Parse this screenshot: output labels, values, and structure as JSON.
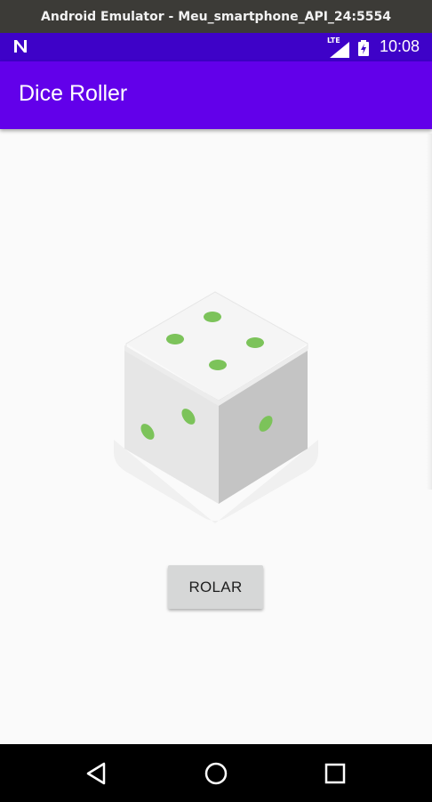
{
  "window": {
    "title": "Android Emulator - Meu_smartphone_API_24:5554"
  },
  "status_bar": {
    "network_label": "LTE",
    "time": "10:08"
  },
  "app_bar": {
    "title": "Dice Roller"
  },
  "dice": {
    "face_value_shown": 4,
    "pip_color": "#7cc35a"
  },
  "roll_button": {
    "label": "ROLAR"
  },
  "nav_bar": {
    "icons": [
      "back-icon",
      "home-icon",
      "recents-icon"
    ]
  }
}
